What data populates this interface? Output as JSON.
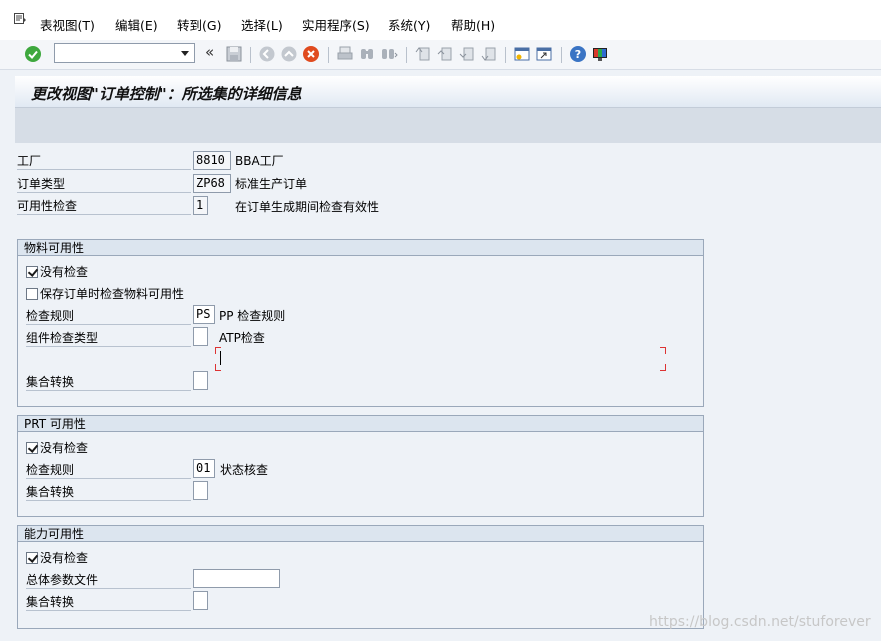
{
  "menu": [
    "表视图(T)",
    "编辑(E)",
    "转到(G)",
    "选择(L)",
    "实用程序(S)",
    "系统(Y)",
    "帮助(H)"
  ],
  "toolbar": {
    "command_value": "",
    "icons": [
      "enter-icon",
      "command-field",
      "back-chevron-icon",
      "save-icon",
      "back-icon",
      "exit-icon",
      "cancel-icon",
      "print-icon",
      "find-icon",
      "find-next-icon",
      "first-page-icon",
      "previous-page-icon",
      "next-page-icon",
      "last-page-icon",
      "create-session-icon",
      "shortcut-icon",
      "help-icon",
      "customize-layout-icon"
    ]
  },
  "title": "更改视图\"订单控制\"：所选集的详细信息",
  "header_fields": {
    "plant_label": "工厂",
    "plant_value": "8810",
    "plant_desc": "BBA工厂",
    "order_type_label": "订单类型",
    "order_type_value": "ZP68",
    "order_type_desc": "标准生产订单",
    "avail_check_label": "可用性检查",
    "avail_check_value": "1",
    "avail_check_desc": "在订单生成期间检查有效性"
  },
  "material": {
    "title": "物料可用性",
    "no_check_label": "没有检查",
    "no_check_checked": true,
    "save_check_label": "保存订单时检查物料可用性",
    "save_check_checked": false,
    "rule_label": "检查规则",
    "rule_value": "PS",
    "rule_desc": "PP 检查规则",
    "comp_type_label": "组件检查类型",
    "comp_type_value": "",
    "comp_type_desc": "ATP检查",
    "collective_label": "集合转换",
    "collective_value": ""
  },
  "prt": {
    "title": "PRT 可用性",
    "no_check_label": "没有检查",
    "no_check_checked": true,
    "rule_label": "检查规则",
    "rule_value": "01",
    "rule_desc": "状态核查",
    "collective_label": "集合转换",
    "collective_value": ""
  },
  "capacity": {
    "title": "能力可用性",
    "no_check_label": "没有检查",
    "no_check_checked": true,
    "profile_label": "总体参数文件",
    "profile_value": "",
    "collective_label": "集合转换",
    "collective_value": ""
  },
  "watermark": "https://blog.csdn.net/stuforever",
  "colors": {
    "background": "#eef2f7",
    "group_header": "#dce5ef",
    "title_gradient_end": "#e1e9f3",
    "cancel_red": "#e04b1f",
    "enter_green": "#2e9a2e"
  }
}
